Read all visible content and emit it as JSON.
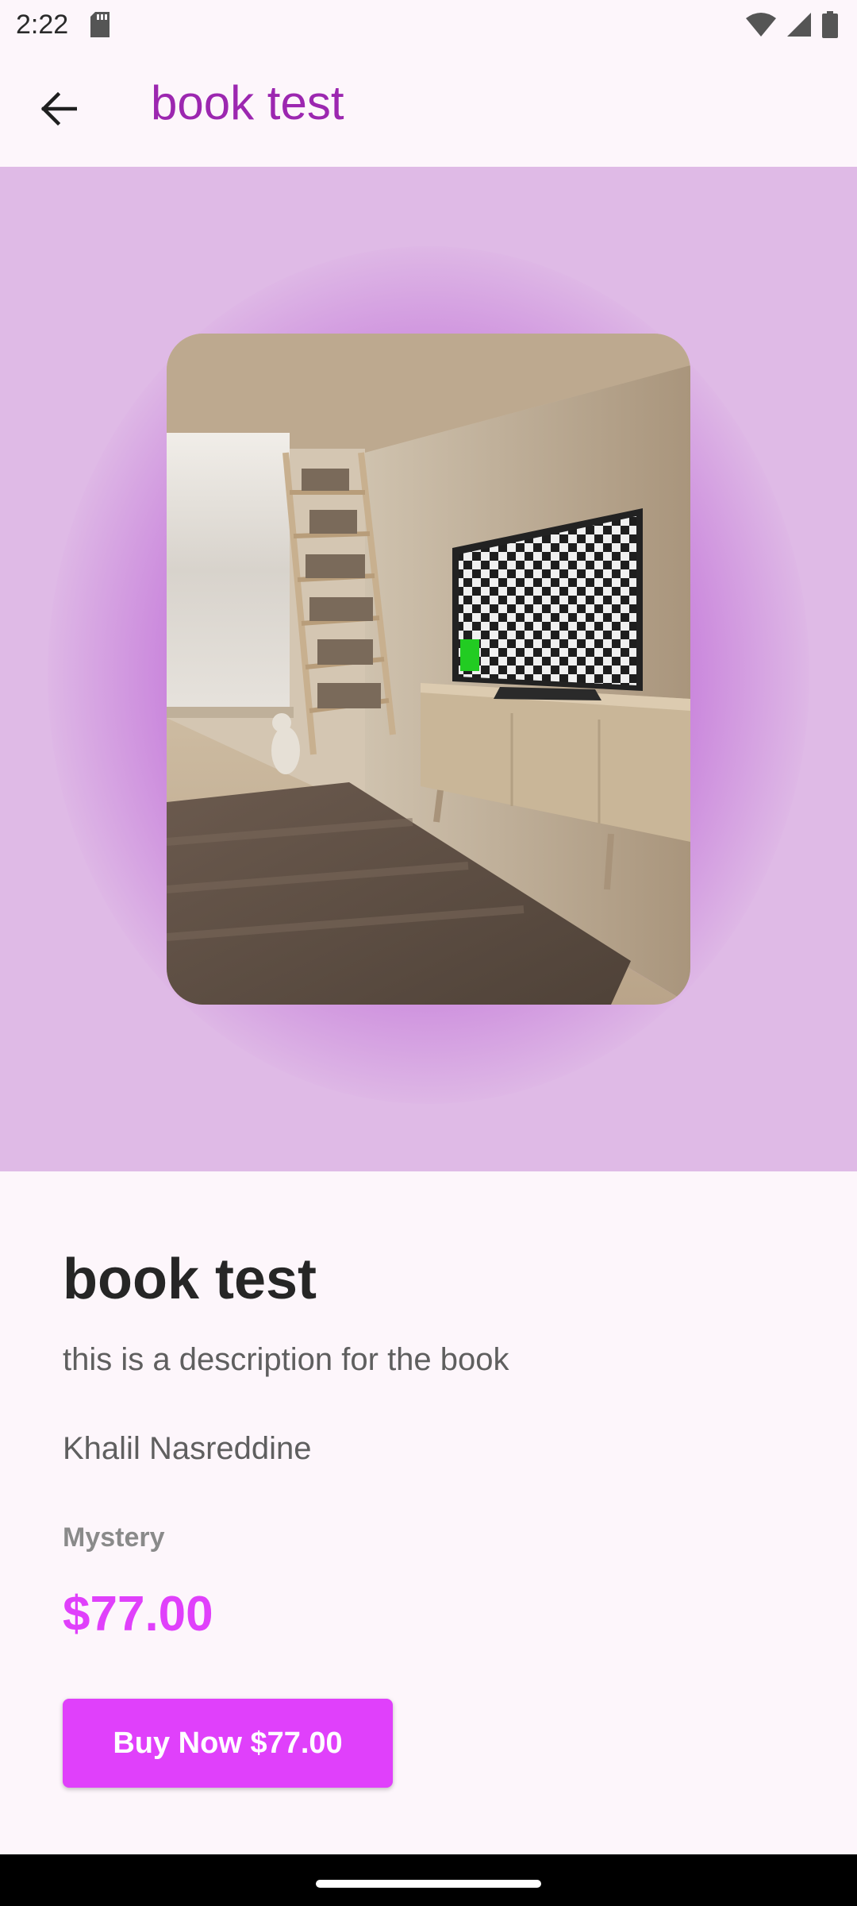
{
  "status_bar": {
    "time": "2:22",
    "icons": [
      "sd-card-icon",
      "wifi-icon",
      "cellular-signal-icon",
      "battery-icon"
    ]
  },
  "app_bar": {
    "title": "book test",
    "back_icon": "arrow-back-icon",
    "title_color": "#9c27b0"
  },
  "hero": {
    "background_color": "#dfbae6",
    "glow_color": "#aa3cc8",
    "cover_image": "book-cover-photo"
  },
  "book": {
    "title": "book test",
    "description": "this is a description for the book",
    "author": "Khalil Nasreddine",
    "genre": "Mystery",
    "price": "$77.00",
    "accent_color": "#e040fb"
  },
  "buy_button": {
    "label": "Buy Now $77.00"
  }
}
